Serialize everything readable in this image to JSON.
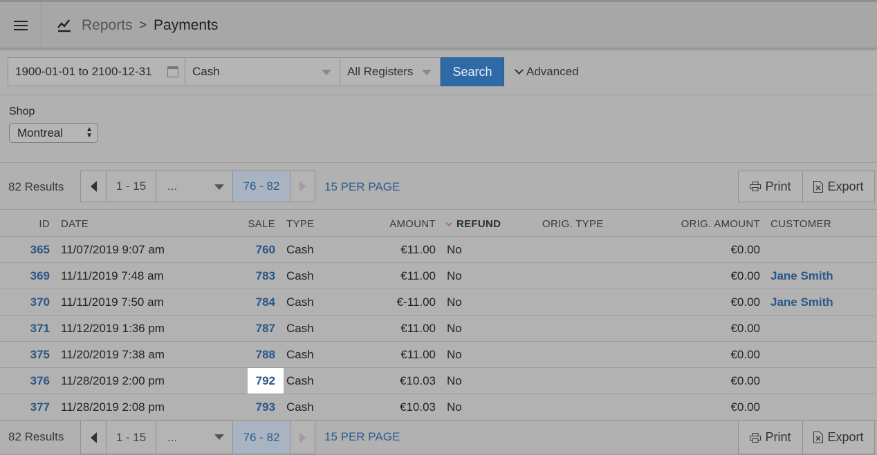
{
  "header": {
    "breadcrumb_root": "Reports",
    "breadcrumb_separator": ">",
    "page_title": "Payments"
  },
  "filters": {
    "date_range": "1900-01-01 to 2100-12-31",
    "payment_type": "Cash",
    "registers": "All Registers",
    "search_label": "Search",
    "advanced_label": "Advanced"
  },
  "shop": {
    "label": "Shop",
    "selected": "Montreal"
  },
  "pagination": {
    "results": "82 Results",
    "first_page": "1 - 15",
    "ellipsis": "...",
    "current_page": "76 - 82",
    "per_page": "15 PER PAGE",
    "print_label": "Print",
    "export_label": "Export"
  },
  "table": {
    "columns": {
      "id": "ID",
      "date": "DATE",
      "sale": "SALE",
      "type": "TYPE",
      "amount": "AMOUNT",
      "refund": "REFUND",
      "orig_type": "ORIG. TYPE",
      "orig_amount": "ORIG. AMOUNT",
      "customer": "CUSTOMER"
    },
    "rows": [
      {
        "id": "365",
        "date": "11/07/2019 9:07 am",
        "sale": "760",
        "type": "Cash",
        "amount": "€11.00",
        "refund": "No",
        "orig_type": "",
        "orig_amount": "€0.00",
        "customer": ""
      },
      {
        "id": "369",
        "date": "11/11/2019 7:48 am",
        "sale": "783",
        "type": "Cash",
        "amount": "€11.00",
        "refund": "No",
        "orig_type": "",
        "orig_amount": "€0.00",
        "customer": "Jane Smith"
      },
      {
        "id": "370",
        "date": "11/11/2019 7:50 am",
        "sale": "784",
        "type": "Cash",
        "amount": "€-11.00",
        "refund": "No",
        "orig_type": "",
        "orig_amount": "€0.00",
        "customer": "Jane Smith"
      },
      {
        "id": "371",
        "date": "11/12/2019 1:36 pm",
        "sale": "787",
        "type": "Cash",
        "amount": "€11.00",
        "refund": "No",
        "orig_type": "",
        "orig_amount": "€0.00",
        "customer": ""
      },
      {
        "id": "375",
        "date": "11/20/2019 7:38 am",
        "sale": "788",
        "type": "Cash",
        "amount": "€11.00",
        "refund": "No",
        "orig_type": "",
        "orig_amount": "€0.00",
        "customer": ""
      },
      {
        "id": "376",
        "date": "11/28/2019 2:00 pm",
        "sale": "792",
        "type": "Cash",
        "amount": "€10.03",
        "refund": "No",
        "orig_type": "",
        "orig_amount": "€0.00",
        "customer": ""
      },
      {
        "id": "377",
        "date": "11/28/2019 2:08 pm",
        "sale": "793",
        "type": "Cash",
        "amount": "€10.03",
        "refund": "No",
        "orig_type": "",
        "orig_amount": "€0.00",
        "customer": ""
      }
    ]
  }
}
